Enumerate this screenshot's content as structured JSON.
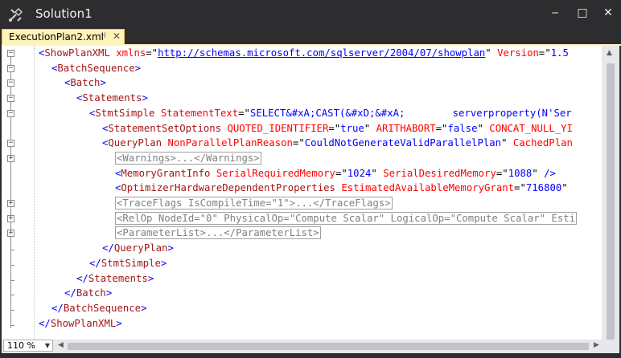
{
  "window": {
    "title": "Solution1",
    "app_icon": "tools-icon",
    "buttons": {
      "minimize": "‒",
      "maximize": "□",
      "close": "✕"
    }
  },
  "tab": {
    "label": "ExecutionPlan2.xml",
    "pin": "⊣",
    "close": "✕"
  },
  "editor": {
    "lines": {
      "l1": {
        "b1": "<",
        "t1": "ShowPlanXML",
        "a1": "xmlns",
        "k1": "=\"",
        "v1": "http://schemas.microsoft.com/sqlserver/2004/07/showplan",
        "k2": "\"",
        "a2": "Version",
        "k3": "=\"",
        "v2": "1.5"
      },
      "l2": {
        "b1": "<",
        "t1": "BatchSequence",
        "b2": ">"
      },
      "l3": {
        "b1": "<",
        "t1": "Batch",
        "b2": ">"
      },
      "l4": {
        "b1": "<",
        "t1": "Statements",
        "b2": ">"
      },
      "l5": {
        "b1": "<",
        "t1": "StmtSimple",
        "a1": "StatementText",
        "k1": "=\"",
        "v1": "SELECT&#xA;CAST(&#xD;&#xA;        serverproperty(N'Ser"
      },
      "l6": {
        "b1": "<",
        "t1": "StatementSetOptions",
        "a1": "QUOTED_IDENTIFIER",
        "k1": "=\"",
        "v1": "true",
        "k2": "\"",
        "a2": "ARITHABORT",
        "k3": "=\"",
        "v2": "false",
        "k4": "\"",
        "a3": "CONCAT_NULL_YI"
      },
      "l7": {
        "b1": "<",
        "t1": "QueryPlan",
        "a1": "NonParallelPlanReason",
        "k1": "=\"",
        "v1": "CouldNotGenerateValidParallelPlan",
        "k2": "\"",
        "a2": "CachedPlan"
      },
      "l8": {
        "c": "<Warnings>...</Warnings>"
      },
      "l9": {
        "b1": "<",
        "t1": "MemoryGrantInfo",
        "a1": "SerialRequiredMemory",
        "k1": "=\"",
        "v1": "1024",
        "k2": "\"",
        "a2": "SerialDesiredMemory",
        "k3": "=\"",
        "v2": "1088",
        "k4": "\"",
        "b2": "/>"
      },
      "l10": {
        "b1": "<",
        "t1": "OptimizerHardwareDependentProperties",
        "a1": "EstimatedAvailableMemoryGrant",
        "k1": "=\"",
        "v1": "716800",
        "k2": "\""
      },
      "l11": {
        "c": "<TraceFlags IsCompileTime=\"1\">...</TraceFlags>"
      },
      "l12": {
        "c": "<RelOp NodeId=\"0\" PhysicalOp=\"Compute Scalar\" LogicalOp=\"Compute Scalar\" Esti"
      },
      "l13": {
        "c": "<ParameterList>...</ParameterList>"
      },
      "l14": {
        "b1": "</",
        "t1": "QueryPlan",
        "b2": ">"
      },
      "l15": {
        "b1": "</",
        "t1": "StmtSimple",
        "b2": ">"
      },
      "l16": {
        "b1": "</",
        "t1": "Statements",
        "b2": ">"
      },
      "l17": {
        "b1": "</",
        "t1": "Batch",
        "b2": ">"
      },
      "l18": {
        "b1": "</",
        "t1": "BatchSequence",
        "b2": ">"
      },
      "l19": {
        "b1": "</",
        "t1": "ShowPlanXML",
        "b2": ">"
      }
    },
    "fold": {
      "expanded": "−",
      "collapsed": "+"
    }
  },
  "statusbar": {
    "zoom": "110 %",
    "zoom_arrow": "▼",
    "scroll_left": "◀",
    "scroll_right": "▶",
    "scroll_up": "▲"
  }
}
